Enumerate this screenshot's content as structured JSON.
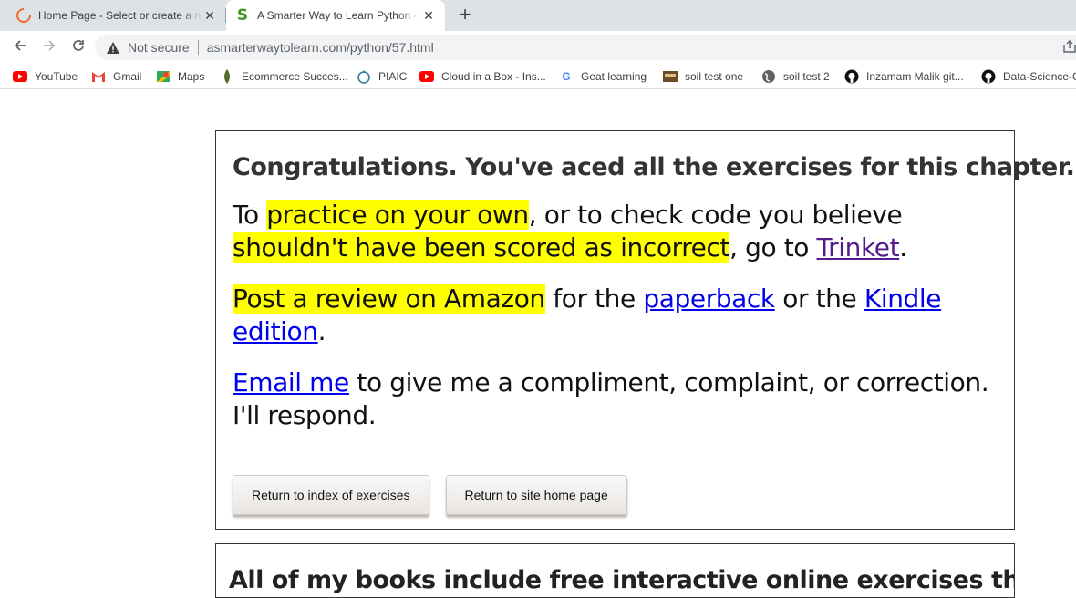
{
  "browser": {
    "tabs": [
      {
        "title": "Home Page - Select or create a notebook",
        "icon": "loading-ring-icon",
        "active": false
      },
      {
        "title": "A Smarter Way to Learn Python - Exercises",
        "icon": "s-logo-icon",
        "active": true
      }
    ],
    "security_label": "Not secure",
    "url": "asmarterwaytolearn.com/python/57.html",
    "bookmarks": [
      {
        "label": "YouTube",
        "icon": "youtube-icon"
      },
      {
        "label": "Gmail",
        "icon": "gmail-icon"
      },
      {
        "label": "Maps",
        "icon": "maps-icon"
      },
      {
        "label": "Ecommerce Succes...",
        "icon": "leaf-icon"
      },
      {
        "label": "PIAIC",
        "icon": "piaic-icon"
      },
      {
        "label": "Cloud in a Box - Ins...",
        "icon": "youtube-icon"
      },
      {
        "label": "Geat learning",
        "icon": "google-icon"
      },
      {
        "label": "soil test one",
        "icon": "site-icon"
      },
      {
        "label": "soil test 2",
        "icon": "globe-icon"
      },
      {
        "label": "Inzamam Malik git...",
        "icon": "github-icon"
      },
      {
        "label": "Data-Science-C",
        "icon": "github-icon"
      }
    ]
  },
  "page": {
    "heading": "Congratulations. You've aced all the exercises for this chapter.",
    "p1": {
      "t1": "To ",
      "hl1": "practice on your own",
      "t2": ", or to check code you believe ",
      "hl2": "shouldn't have been scored as incorrect",
      "t3": ", go to ",
      "link": "Trinket",
      "t4": "."
    },
    "p2": {
      "hl": "Post a review on Amazon",
      "t1": " for the ",
      "link1": "paperback",
      "t2": " or the ",
      "link2": "Kindle edition",
      "t3": "."
    },
    "p3": {
      "link": "Email me",
      "t1": " to give me a compliment, complaint, or correction. I'll respond."
    },
    "buttons": {
      "index": "Return to index of exercises",
      "home": "Return to site home page"
    },
    "box2_heading": "All of my books include free interactive online exercises that"
  },
  "colors": {
    "highlight": "#ffff00",
    "link": "#0000ee",
    "visited_link": "#551a8b"
  }
}
